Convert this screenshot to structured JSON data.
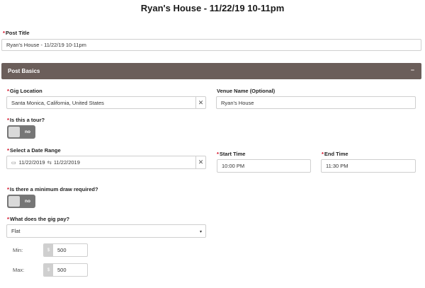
{
  "page": {
    "title": "Ryan's House - 11/22/19 10-11pm"
  },
  "post_title": {
    "label": "Post Title",
    "value": "Ryan's House - 11/22/19 10-11pm"
  },
  "section": {
    "label": "Post Basics",
    "collapse_icon": "−"
  },
  "gig_location": {
    "label": "Gig Location",
    "value": "Santa Monica, California, United States"
  },
  "venue_name": {
    "label": "Venue Name (Optional)",
    "value": "Ryan's House"
  },
  "tour": {
    "label": "Is this a tour?",
    "toggle_text": "no"
  },
  "date_range": {
    "label": "Select a Date Range",
    "start": "11/22/2019",
    "arrow": "⇆",
    "end": "11/22/2019"
  },
  "start_time": {
    "label": "Start Time",
    "value": "10:00 PM"
  },
  "end_time": {
    "label": "End Time",
    "value": "11:30 PM"
  },
  "min_draw": {
    "label": "Is there a minimum draw required?",
    "toggle_text": "no"
  },
  "gig_pay": {
    "label": "What does the gig pay?",
    "value": "Flat",
    "caret": "▾"
  },
  "pay_min": {
    "label": "Min:",
    "currency": "$",
    "value": "500"
  },
  "pay_max": {
    "label": "Max:",
    "currency": "$",
    "value": "500"
  },
  "icons": {
    "clear": "✕",
    "calendar": "▭"
  }
}
